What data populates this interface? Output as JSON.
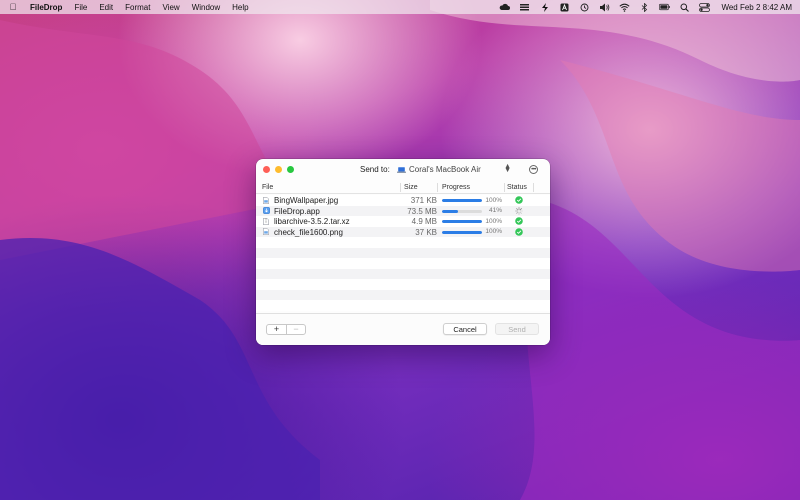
{
  "menubar": {
    "app_name": "FileDrop",
    "items": [
      "File",
      "Edit",
      "Format",
      "View",
      "Window",
      "Help"
    ],
    "clock": "Wed Feb 2  8:42 AM",
    "status_icons": [
      "cloud-icon",
      "stack-icon",
      "bolt-icon",
      "a-icon",
      "time-machine-icon",
      "volume-icon",
      "wifi-icon",
      "bluetooth-icon",
      "battery-icon",
      "search-icon",
      "control-center-icon"
    ]
  },
  "window": {
    "send_to_label": "Send to:",
    "device_name": "Coral's MacBook Air",
    "columns": {
      "file": "File",
      "size": "Size",
      "progress": "Progress",
      "status": "Status"
    },
    "files": [
      {
        "name": "BingWallpaper.jpg",
        "size": "371 KB",
        "progress": 1.0,
        "percent_text": "100%",
        "status": "done",
        "icon": "image-file-icon"
      },
      {
        "name": "FileDrop.app",
        "size": "73.5 MB",
        "progress": 0.41,
        "percent_text": "41%",
        "status": "in-progress",
        "icon": "app-file-icon"
      },
      {
        "name": "libarchive-3.5.2.tar.xz",
        "size": "4.9 MB",
        "progress": 1.0,
        "percent_text": "100%",
        "status": "done",
        "icon": "archive-file-icon"
      },
      {
        "name": "check_file1600.png",
        "size": "37 KB",
        "progress": 1.0,
        "percent_text": "100%",
        "status": "done",
        "icon": "image-file-icon"
      }
    ],
    "empty_rows": 7,
    "add_label": "+",
    "remove_label": "−",
    "cancel_label": "Cancel",
    "send_label": "Send"
  },
  "colors": {
    "accent": "#2b7de6",
    "success": "#34c759",
    "close": "#fe5f57",
    "minimize": "#febc2e",
    "zoom": "#28c840"
  }
}
